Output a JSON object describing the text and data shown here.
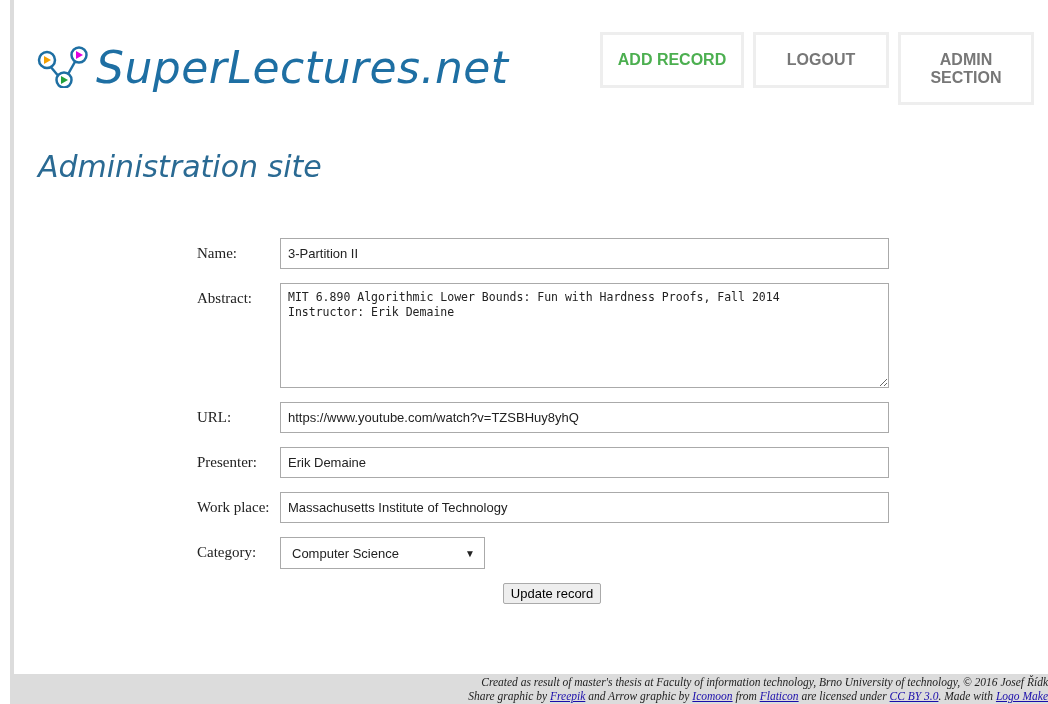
{
  "logo": {
    "text": "SuperLectures.net"
  },
  "nav": [
    {
      "label": "ADD RECORD",
      "selected": true
    },
    {
      "label": "LOGOUT",
      "selected": false
    },
    {
      "label": "ADMIN SECTION",
      "selected": false
    }
  ],
  "heading": "Administration site",
  "form": {
    "fields": [
      {
        "kind": "text",
        "label": "Name:",
        "value": "3-Partition II"
      },
      {
        "kind": "textarea",
        "label": "Abstract:",
        "value": "MIT 6.890 Algorithmic Lower Bounds: Fun with Hardness Proofs, Fall 2014\nInstructor: Erik Demaine"
      },
      {
        "kind": "text",
        "label": "URL:",
        "value": "https://www.youtube.com/watch?v=TZSBHuy8yhQ"
      },
      {
        "kind": "text",
        "label": "Presenter:",
        "value": "Erik Demaine"
      },
      {
        "kind": "text",
        "label": "Work place:",
        "value": "Massachusetts Institute of Technology"
      },
      {
        "kind": "select",
        "label": "Category:",
        "value": "Computer Science",
        "arrow": "▼"
      }
    ],
    "submit": "Update record"
  },
  "footer": {
    "line_1": "Created as result of master's thesis at Faculty of information technology, Brno University of technology, © 2016 Josef Řídk",
    "line_2": [
      {
        "text": "Share graphic by ",
        "link": false
      },
      {
        "text": "Freepik",
        "link": true
      },
      {
        "text": " and Arrow graphic by ",
        "link": false
      },
      {
        "text": "Icomoon",
        "link": true
      },
      {
        "text": " from ",
        "link": false
      },
      {
        "text": "Flaticon",
        "link": true
      },
      {
        "text": " are licensed under ",
        "link": false
      },
      {
        "text": "CC BY 3.0",
        "link": true
      },
      {
        "text": ". Made with ",
        "link": false
      },
      {
        "text": "Logo Make",
        "link": true
      }
    ]
  }
}
